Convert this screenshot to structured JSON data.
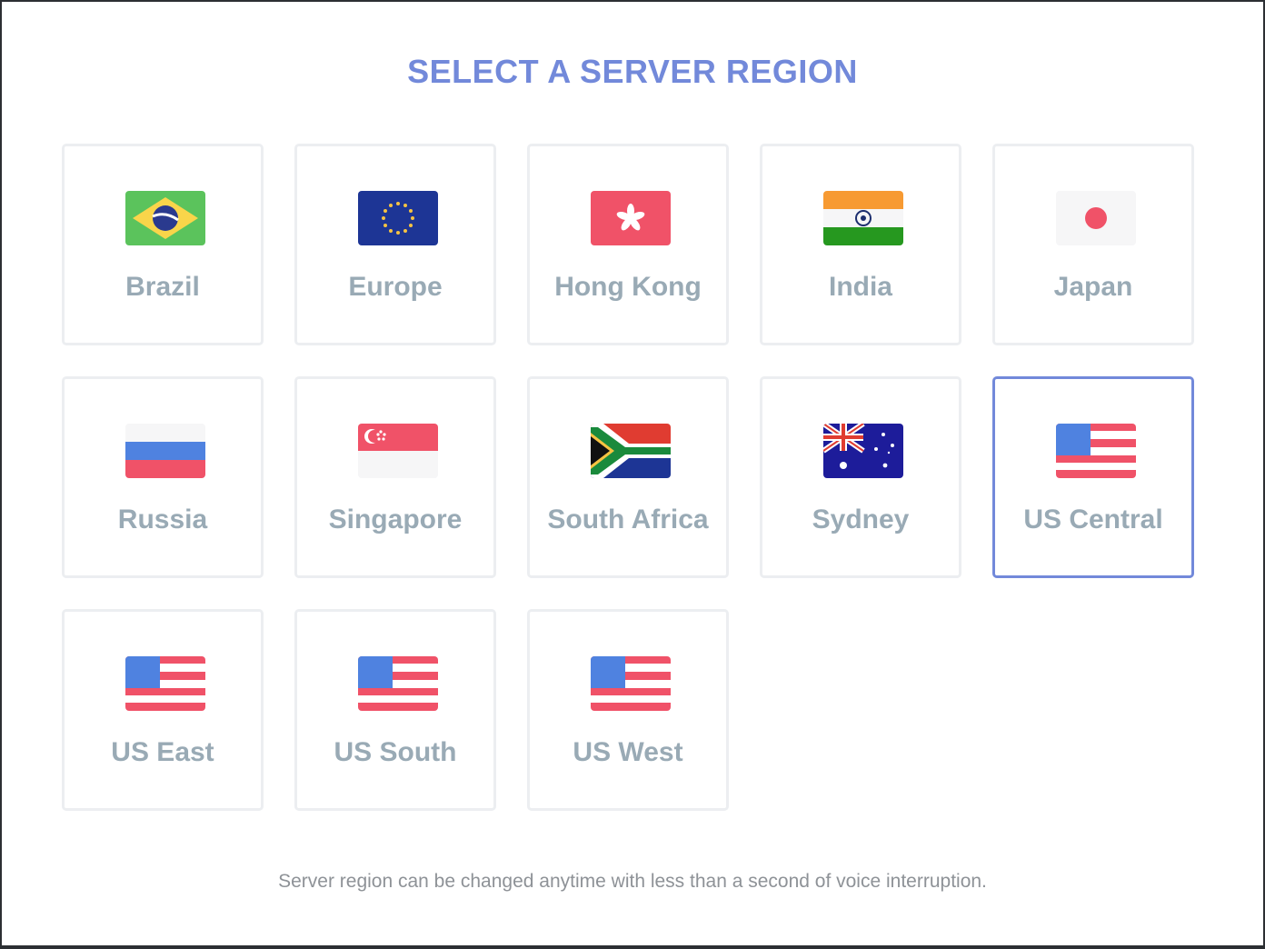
{
  "modal": {
    "title": "SELECT A SERVER REGION",
    "footer": "Server region can be changed anytime with less than a second of voice interruption.",
    "selected_region": "US Central",
    "regions": [
      {
        "label": "Brazil",
        "icon": "brazil-flag-icon"
      },
      {
        "label": "Europe",
        "icon": "eu-flag-icon"
      },
      {
        "label": "Hong Kong",
        "icon": "hong-kong-flag-icon"
      },
      {
        "label": "India",
        "icon": "india-flag-icon"
      },
      {
        "label": "Japan",
        "icon": "japan-flag-icon"
      },
      {
        "label": "Russia",
        "icon": "russia-flag-icon"
      },
      {
        "label": "Singapore",
        "icon": "singapore-flag-icon"
      },
      {
        "label": "South Africa",
        "icon": "south-africa-flag-icon"
      },
      {
        "label": "Sydney",
        "icon": "australia-flag-icon"
      },
      {
        "label": "US Central",
        "icon": "us-flag-icon"
      },
      {
        "label": "US East",
        "icon": "us-flag-icon"
      },
      {
        "label": "US South",
        "icon": "us-flag-icon"
      },
      {
        "label": "US West",
        "icon": "us-flag-icon"
      }
    ]
  },
  "colors": {
    "accent": "#7289da",
    "label": "#99aab5",
    "tile_border": "#eceef1",
    "footer_text": "#8e9297"
  }
}
